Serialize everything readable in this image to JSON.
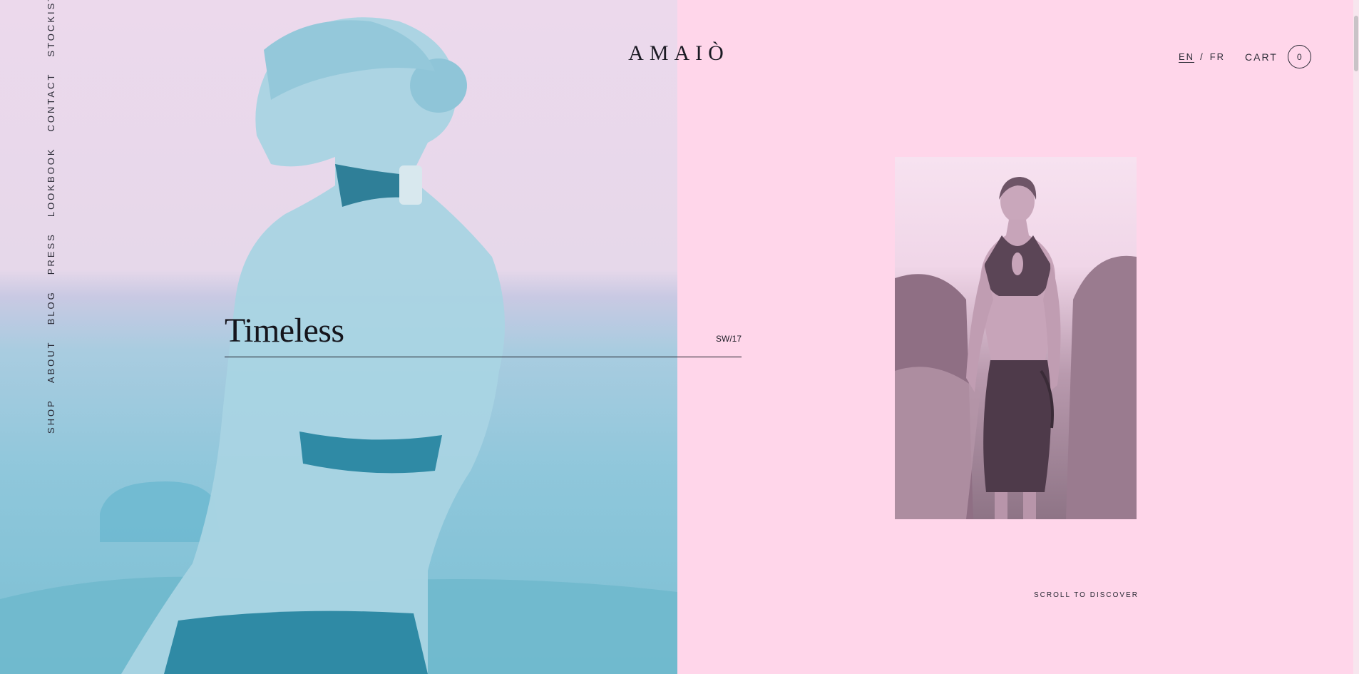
{
  "brand": {
    "logo": "AMAIÒ"
  },
  "nav": {
    "items": [
      {
        "label": "SHOP"
      },
      {
        "label": "ABOUT"
      },
      {
        "label": "BLOG"
      },
      {
        "label": "PRESS"
      },
      {
        "label": "LOOKBOOK"
      },
      {
        "label": "CONTACT"
      },
      {
        "label": "STOCKISTS"
      }
    ]
  },
  "header": {
    "lang_en": "EN",
    "lang_sep": "/",
    "lang_fr": "FR",
    "cart_label": "CART",
    "cart_count": "0"
  },
  "hero": {
    "headline": "Timeless",
    "season": "SW/17"
  },
  "footer": {
    "scroll_text": "SCROLL TO DISCOVER"
  },
  "colors": {
    "background": "#ffd6ea",
    "text": "#1b1b24",
    "hero_tint": "#7bbfd3"
  }
}
